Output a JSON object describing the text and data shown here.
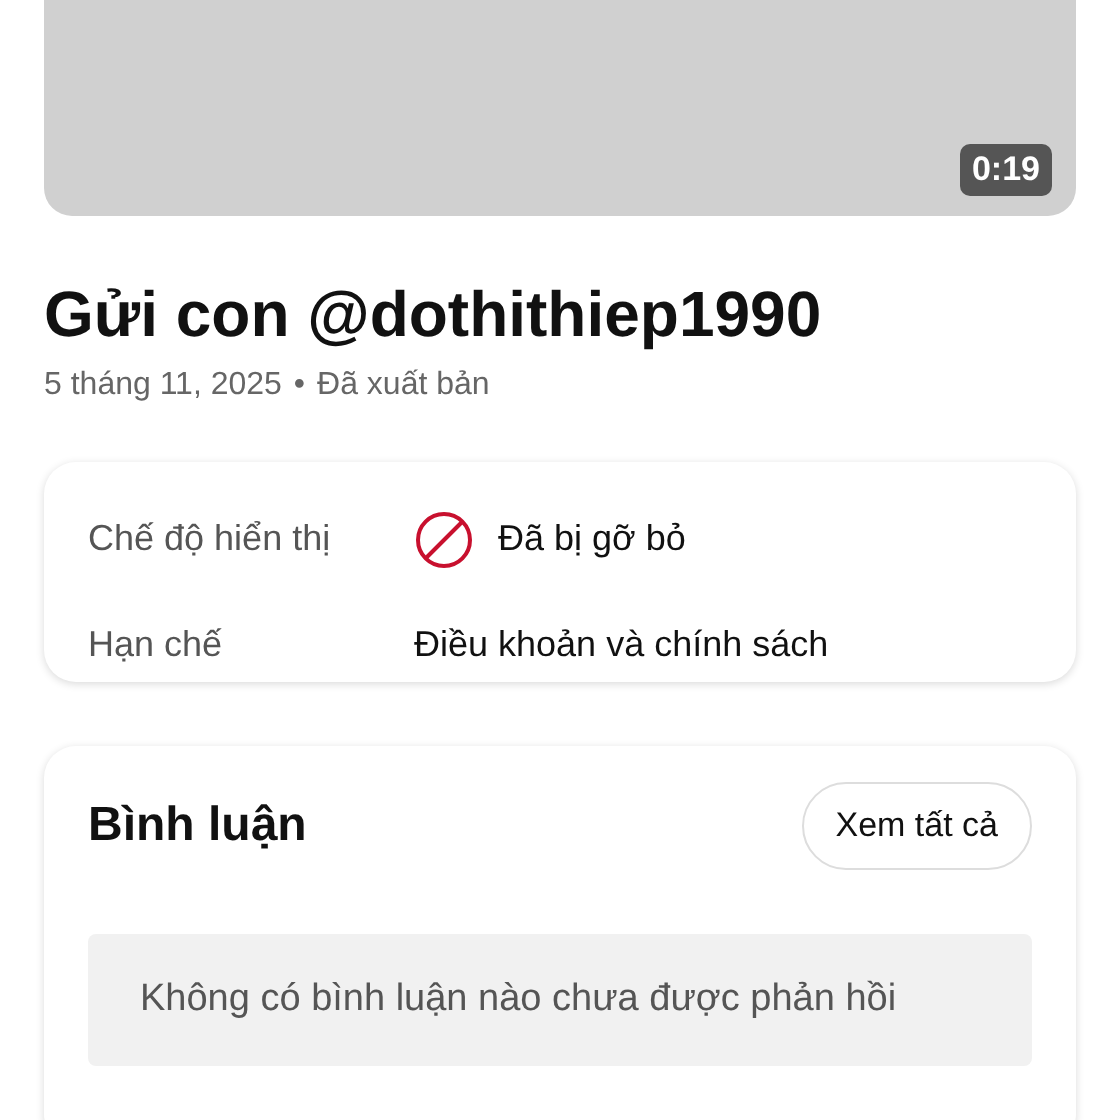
{
  "video": {
    "kind": "picture",
    "duration": "0:19"
  },
  "post": {
    "title": "Gửi con @dothithiep1990",
    "date": "5 tháng 11, 2025",
    "separator": "•",
    "status": "Đã xuất bản"
  },
  "details": [
    {
      "kind": "status",
      "label": "Chế độ hiển thị",
      "value": "Đã bị gỡ bỏ"
    },
    {
      "kind": "text",
      "label": "Hạn chế",
      "value": "Điều khoản và chính sách"
    }
  ],
  "comments": {
    "title": "Bình luận",
    "button": "Xem tất cả",
    "empty_message": "Không có bình luận nào chưa được phản hồi"
  }
}
